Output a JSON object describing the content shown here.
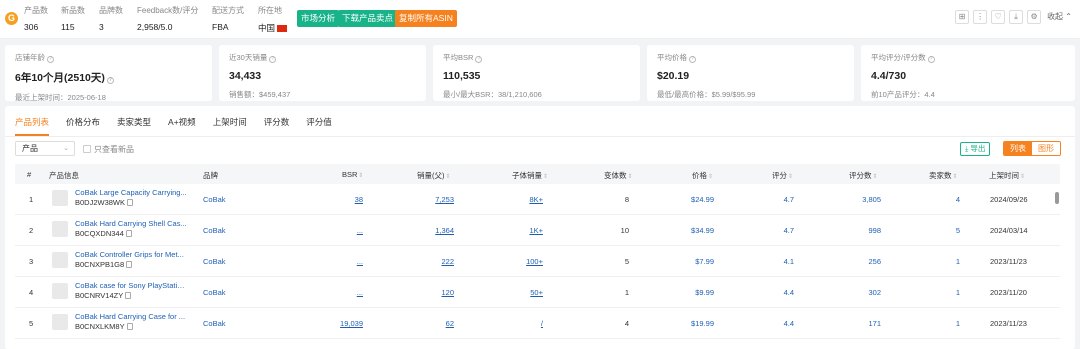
{
  "topbar": {
    "stats": [
      {
        "label": "产品数",
        "value": "306"
      },
      {
        "label": "新品数",
        "value": "115"
      },
      {
        "label": "品牌数",
        "value": "3"
      },
      {
        "label": "Feedback数/评分",
        "value": "2,958/5.0"
      },
      {
        "label": "配送方式",
        "value": "FBA"
      },
      {
        "label": "所在地",
        "value": "中国"
      }
    ],
    "buttons": {
      "market": "市场分析",
      "download": "下载产品卖点",
      "copy_asin": "复制所有ASIN"
    },
    "collapse": "收起"
  },
  "cards": [
    {
      "label": "店铺年龄",
      "value": "6年10个月(2510天)",
      "sub": "最近上架时间：2025-06-18"
    },
    {
      "label": "近30天销量",
      "value": "34,433",
      "sub": "销售额：$459,437"
    },
    {
      "label": "平均BSR",
      "value": "110,535",
      "sub": "最小/最大BSR：38/1,210,606"
    },
    {
      "label": "平均价格",
      "value": "$20.19",
      "sub": "最低/最高价格：$5.99/$95.99"
    },
    {
      "label": "平均评分/评分数",
      "value": "4.4/730",
      "sub": "前10产品评分：4.4"
    }
  ],
  "tabs": [
    "产品列表",
    "价格分布",
    "卖家类型",
    "A+视频",
    "上架时间",
    "评分数",
    "评分值"
  ],
  "filter": {
    "select": "产品",
    "checkbox": "只查看新品",
    "export": "导出",
    "view_list": "列表",
    "view_chart": "图形"
  },
  "table": {
    "headers": {
      "idx": "#",
      "info": "产品信息",
      "brand": "品牌",
      "bsr": "BSR",
      "sales": "销量(父)",
      "child": "子体销量",
      "variants": "变体数",
      "price": "价格",
      "rating": "评分",
      "ratings": "评分数",
      "sellers": "卖家数",
      "date": "上架时间"
    },
    "rows": [
      {
        "idx": "1",
        "name": "CoBak Large Capacity Carrying...",
        "asin": "B0DJ2W38WK",
        "brand": "CoBak",
        "bsr": "38",
        "sales": "7,253",
        "child": "8K+",
        "variants": "8",
        "price": "$24.99",
        "rating": "4.7",
        "ratings": "3,805",
        "sellers": "4",
        "date": "2024/09/26"
      },
      {
        "idx": "2",
        "name": "CoBak Hard Carrying Shell Cas...",
        "asin": "B0CQXDN344",
        "brand": "CoBak",
        "bsr": "...",
        "sales": "1,364",
        "child": "1K+",
        "variants": "10",
        "price": "$34.99",
        "rating": "4.7",
        "ratings": "998",
        "sellers": "5",
        "date": "2024/03/14"
      },
      {
        "idx": "3",
        "name": "CoBak Controller Grips for Met...",
        "asin": "B0CNXPB1G8",
        "brand": "CoBak",
        "bsr": "...",
        "sales": "222",
        "child": "100+",
        "variants": "5",
        "price": "$7.99",
        "rating": "4.1",
        "ratings": "256",
        "sellers": "1",
        "date": "2023/11/23"
      },
      {
        "idx": "4",
        "name": "CoBak case for Sony PlayStatio...",
        "asin": "B0CNRV14ZY",
        "brand": "CoBak",
        "bsr": "...",
        "sales": "120",
        "child": "50+",
        "variants": "1",
        "price": "$9.99",
        "rating": "4.4",
        "ratings": "302",
        "sellers": "1",
        "date": "2023/11/20"
      },
      {
        "idx": "5",
        "name": "CoBak Hard Carrying Case for ...",
        "asin": "B0CNXLKM8Y",
        "brand": "CoBak",
        "bsr": "19,039",
        "sales": "62",
        "child": "/",
        "variants": "4",
        "price": "$19.99",
        "rating": "4.4",
        "ratings": "171",
        "sellers": "1",
        "date": "2023/11/23"
      }
    ]
  },
  "colors": {
    "accent": "#f5811f",
    "green": "#19b38a",
    "link": "#1e5fb4"
  }
}
